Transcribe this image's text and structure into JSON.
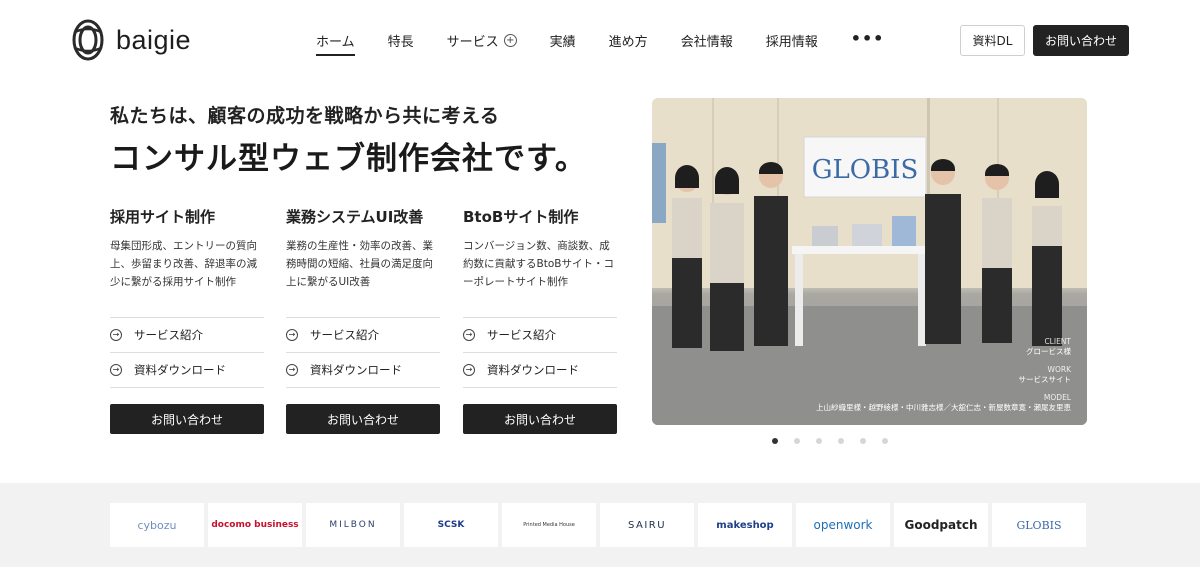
{
  "header": {
    "logo_text": "baigie",
    "nav": [
      {
        "label": "ホーム",
        "active": true
      },
      {
        "label": "特長"
      },
      {
        "label": "サービス",
        "expandable": true
      },
      {
        "label": "実績"
      },
      {
        "label": "進め方"
      },
      {
        "label": "会社情報"
      },
      {
        "label": "採用情報"
      }
    ],
    "more_icon": "more-icon",
    "download_label": "資料DL",
    "contact_label": "お問い合わせ"
  },
  "hero": {
    "subtitle": "私たちは、顧客の成功を戦略から共に考える",
    "title": "コンサル型ウェブ制作会社です。"
  },
  "services": [
    {
      "title": "採用サイト制作",
      "description": "母集団形成、エントリーの質向上、歩留まり改善、辞退率の減少に繋がる採用サイト制作",
      "links": [
        "サービス紹介",
        "資料ダウンロード"
      ],
      "button": "お問い合わせ"
    },
    {
      "title": "業務システムUI改善",
      "description": "業務の生産性・効率の改善、業務時間の短縮、社員の満足度向上に繋がるUI改善",
      "links": [
        "サービス紹介",
        "資料ダウンロード"
      ],
      "button": "お問い合わせ"
    },
    {
      "title": "BtoBサイト制作",
      "description": "コンバージョン数、商談数、成約数に貢献するBtoBサイト・コーポレートサイト制作",
      "links": [
        "サービス紹介",
        "資料ダウンロード"
      ],
      "button": "お問い合わせ"
    }
  ],
  "photo": {
    "sign_text": "GLOBIS",
    "client_label": "CLIENT",
    "client_value": "グロービス様",
    "work_label": "WORK",
    "work_value": "サービスサイト",
    "model_label": "MODEL",
    "model_value": "上山紗織里様・越野綾様・中川雅志様／大舘仁志・新屋数章寛・瀬尾友里恵"
  },
  "carousel": {
    "count": 6,
    "active_index": 0
  },
  "clients": [
    "cybozu",
    "docomo business",
    "MILBON",
    "SCSK",
    "Printed Media House",
    "SAIRU",
    "makeshop",
    "openwork",
    "Goodpatch",
    "GLOBIS"
  ],
  "colors": {
    "text": "#222222",
    "button_dark": "#222222",
    "band": "#f2f2f2",
    "divider": "#dedede"
  }
}
